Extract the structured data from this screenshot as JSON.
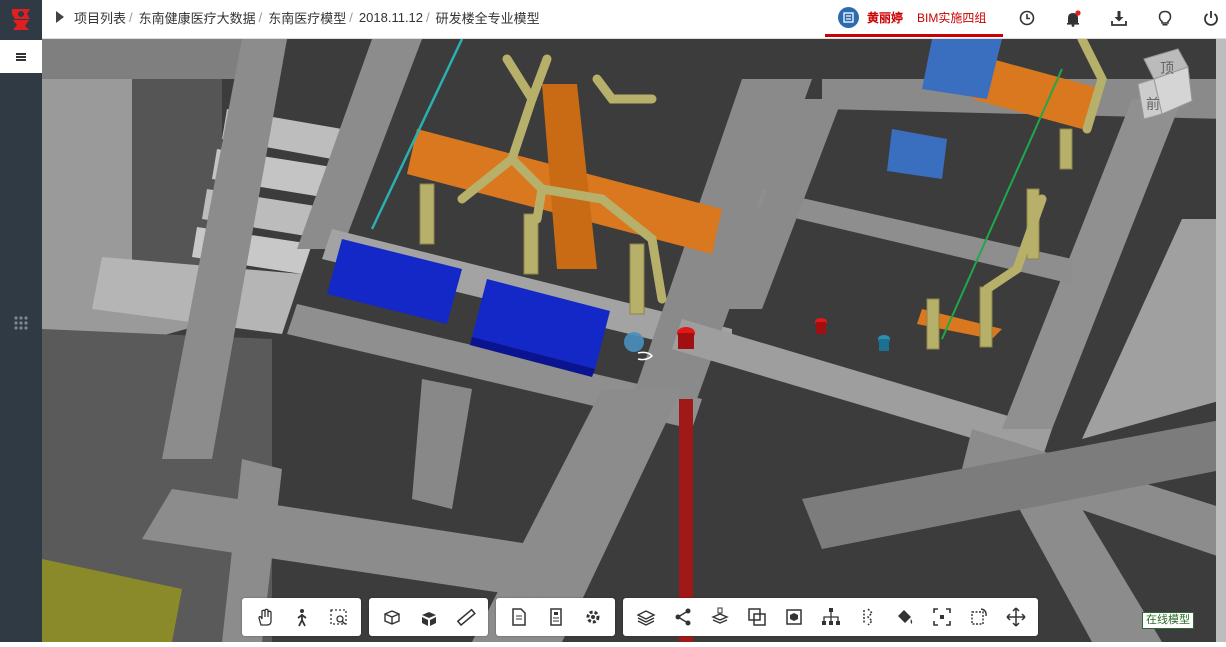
{
  "breadcrumb": {
    "items": [
      "项目列表",
      "东南健康医疗大数据",
      "东南医疗模型",
      "2018.11.12",
      "研发楼全专业模型"
    ],
    "separator": "/"
  },
  "user": {
    "name": "黄丽婷",
    "group": "BIM实施四组"
  },
  "top_icons": [
    "history-icon",
    "notification-icon",
    "download-icon",
    "lightbulb-icon",
    "power-icon"
  ],
  "toolbar": {
    "groups": [
      [
        "pan-icon",
        "walk-icon",
        "zoom-window-icon"
      ],
      [
        "section-box-icon",
        "explode-icon",
        "measure-icon"
      ],
      [
        "properties-icon",
        "structure-tree-icon",
        "settings-icon"
      ],
      [
        "layers-icon",
        "share-icon",
        "model-layer-icon",
        "overlap-icon",
        "cube-icon",
        "hierarchy-icon",
        "isolate-icon",
        "paint-icon",
        "fit-icon",
        "rotate-icon",
        "move-icon"
      ]
    ]
  },
  "viewcube": {
    "top": "顶",
    "front": "前"
  },
  "status": {
    "online_label": "在线模型"
  },
  "colors": {
    "accent_red": "#cc0000",
    "sidebar": "#2f3a44",
    "duct_orange": "#d9781e",
    "pipe_yellow": "#b7b06a",
    "equipment_blue": "#1428c8",
    "slab_gray": "#8a8a8a"
  }
}
